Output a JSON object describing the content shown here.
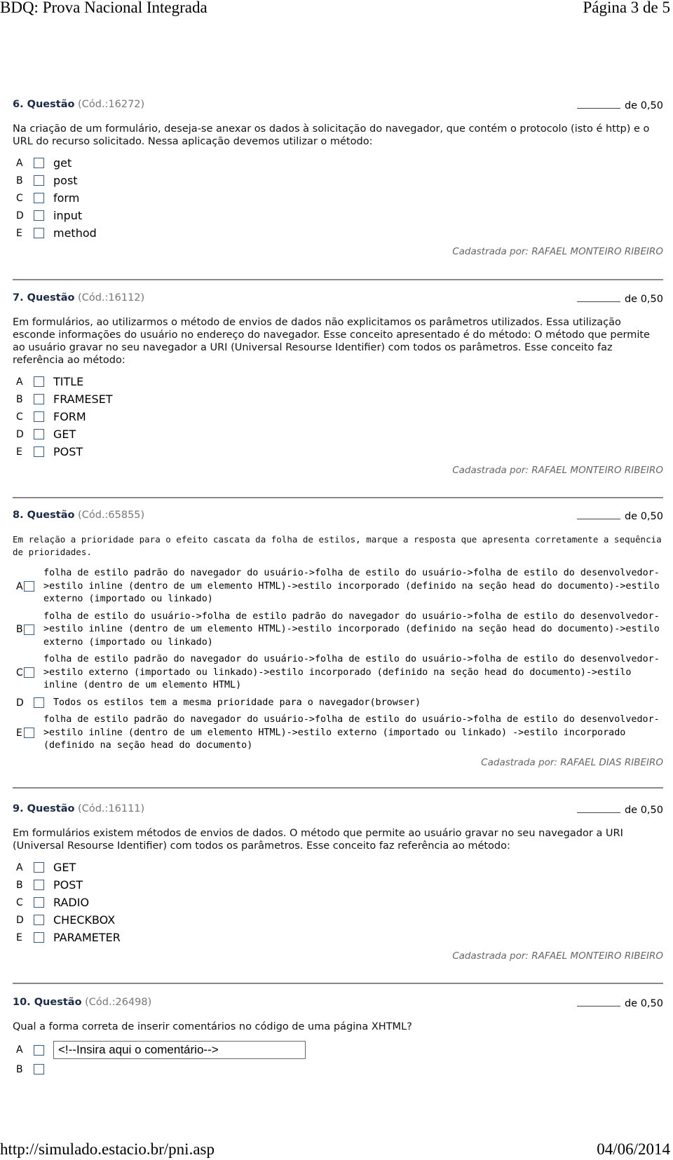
{
  "header": {
    "title": "BDQ: Prova Nacional Integrada",
    "page": "Página 3 de 5"
  },
  "footer": {
    "url": "http://simulado.estacio.br/pni.asp",
    "date": "04/06/2014"
  },
  "questions": [
    {
      "number": "6. Questão",
      "code": "(Cód.:16272)",
      "score": "de 0,50",
      "text": "Na criação de um formulário, deseja-se anexar os dados à solicitação do navegador, que contém o protocolo (isto é http) e o URL do recurso solicitado. Nessa aplicação devemos utilizar o método:",
      "options": [
        {
          "letter": "A",
          "text": "get"
        },
        {
          "letter": "B",
          "text": "post"
        },
        {
          "letter": "C",
          "text": "form"
        },
        {
          "letter": "D",
          "text": "input"
        },
        {
          "letter": "E",
          "text": "method"
        }
      ],
      "author": "Cadastrada por: RAFAEL MONTEIRO RIBEIRO"
    },
    {
      "number": "7. Questão",
      "code": "(Cód.:16112)",
      "score": "de 0,50",
      "text": "Em formulários, ao utilizarmos o método de envios de dados não explicitamos os parâmetros utilizados. Essa utilização esconde informações do usuário no endereço do navegador. Esse conceito apresentado é do método: O método que permite ao usuário gravar no seu navegador a URI (Universal Resourse Identifier) com todos os parâmetros. Esse conceito faz referência ao método:",
      "options": [
        {
          "letter": "A",
          "text": "TITLE"
        },
        {
          "letter": "B",
          "text": "FRAMESET"
        },
        {
          "letter": "C",
          "text": "FORM"
        },
        {
          "letter": "D",
          "text": "GET"
        },
        {
          "letter": "E",
          "text": "POST"
        }
      ],
      "author": "Cadastrada por: RAFAEL MONTEIRO RIBEIRO"
    },
    {
      "number": "8. Questão",
      "code": "(Cód.:65855)",
      "score": "de 0,50",
      "text": "Em relação a  prioridade para o efeito cascata da folha de estilos, marque a resposta que apresenta corretamente a sequência de prioridades.",
      "options": [
        {
          "letter": "A",
          "text": "folha de estilo padrão do navegador do usuário->folha de estilo do usuário->folha de estilo do desenvolvedor->estilo inline (dentro de um elemento HTML)->estilo incorporado (definido na seção head do documento)->estilo externo (importado ou linkado)"
        },
        {
          "letter": "B",
          "text": "folha de estilo do usuário->folha de estilo padrão do navegador do usuário->folha de estilo do desenvolvedor->estilo inline (dentro de um elemento HTML)->estilo incorporado (definido na seção head do documento)->estilo externo (importado ou linkado)"
        },
        {
          "letter": "C",
          "text": "folha de estilo padrão do navegador do usuário->folha de estilo do usuário->folha de estilo do desenvolvedor->estilo externo (importado ou linkado)->estilo incorporado (definido na seção head do documento)->estilo inline (dentro de um elemento HTML)"
        },
        {
          "letter": "D",
          "text": "Todos os estilos tem a mesma prioridade para o navegador(browser)"
        },
        {
          "letter": "E",
          "text": "folha de estilo padrão do navegador do usuário->folha de estilo do usuário->folha de estilo do desenvolvedor->estilo inline (dentro de um elemento HTML)->estilo externo (importado ou linkado) ->estilo incorporado (definido na seção head do documento)"
        }
      ],
      "author": "Cadastrada por: RAFAEL DIAS RIBEIRO"
    },
    {
      "number": "9. Questão",
      "code": "(Cód.:16111)",
      "score": "de 0,50",
      "text": "Em formulários existem métodos de envios de dados. O método que permite ao usuário gravar no seu navegador a URI (Universal Resourse Identifier) com todos os parâmetros. Esse conceito faz referência ao método:",
      "options": [
        {
          "letter": "A",
          "text": "GET"
        },
        {
          "letter": "B",
          "text": "POST"
        },
        {
          "letter": "C",
          "text": "RADIO"
        },
        {
          "letter": "D",
          "text": "CHECKBOX"
        },
        {
          "letter": "E",
          "text": "PARAMETER"
        }
      ],
      "author": "Cadastrada por: RAFAEL MONTEIRO RIBEIRO"
    },
    {
      "number": "10. Questão",
      "code": "(Cód.:26498)",
      "score": "de 0,50",
      "text": "Qual a forma correta de inserir comentários no código de uma página XHTML?",
      "options": [
        {
          "letter": "A",
          "text": "<!--Insira aqui o comentário-->"
        },
        {
          "letter": "B",
          "text": ""
        }
      ]
    }
  ]
}
